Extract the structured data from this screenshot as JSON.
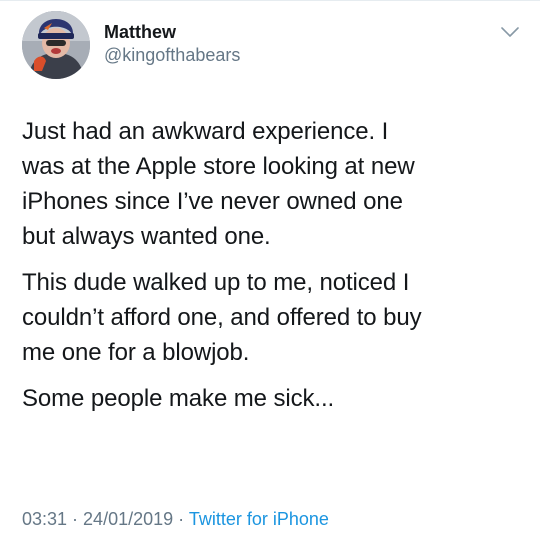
{
  "author": {
    "display_name": "Matthew",
    "handle": "@kingofthabears",
    "avatar_icon": "user-avatar-photo"
  },
  "tweet": {
    "paragraphs": [
      {
        "lines": [
          "Just had an awkward experience. I",
          "was at the Apple store looking at new",
          "iPhones since I’ve never owned one",
          "but always wanted one."
        ]
      },
      {
        "lines": [
          "This dude walked up to me, noticed I",
          "couldn’t afford one, and offered to buy",
          "me one for a blowjob."
        ]
      },
      {
        "lines": [
          "Some people make me sick..."
        ]
      }
    ]
  },
  "meta": {
    "time": "03:31",
    "separator": " · ",
    "date": "24/01/2019",
    "source": "Twitter for iPhone"
  },
  "icons": {
    "caret": "chevron-down-icon"
  },
  "colors": {
    "text": "#14171a",
    "secondary": "#657786",
    "link": "#1b95e0"
  }
}
